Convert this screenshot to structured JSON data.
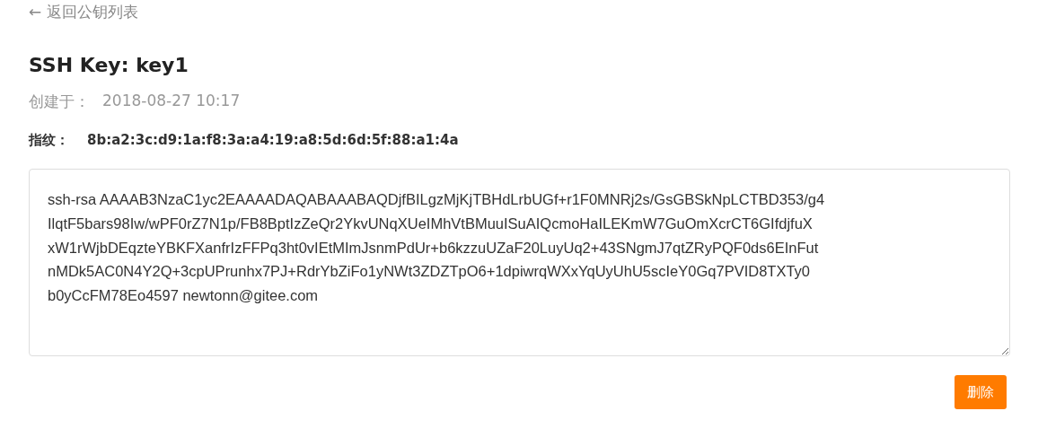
{
  "back_link": "← 返回公钥列表",
  "title": "SSH Key: key1",
  "created": {
    "label": "创建于：",
    "value": "2018-08-27 10:17"
  },
  "fingerprint": {
    "label": "指纹：",
    "value": "8b:a2:3c:d9:1a:f8:3a:a4:19:a8:5d:6d:5f:88:a1:4a"
  },
  "key_lines": [
    "ssh-rsa AAAAB3NzaC1yc2EAAAADAQABAAABAQDjfBILgzMjKjTBHdLrbUGf+r1F0MNRj2s/GsGBSkNpLCTBD353/g4",
    "IlqtF5bars98Iw/wPF0rZ7N1p/FB8BptIzZeQr2YkvUNqXUeIMhVtBMuuISuAIQcmoHaILEKmW7GuOmXcrCT6GIfdjfuX",
    "xW1rWjbDEqzteYBKFXanfrIzFFPq3ht0vIEtMImJsnmPdUr+b6kzzuUZaF20LuyUq2+43SNgmJ7qtZRyPQF0ds6EInFut",
    "nMDk5AC0N4Y2Q+3cpUPrunhx7PJ+RdrYbZiFo1yNWt3ZDZTpO6+1dpiwrqWXxYqUyUhU5scIeY0Gq7PVID8TXTy0",
    "b0yCcFM78Eo4597 newtonn@gitee.com"
  ],
  "delete_button": "删除"
}
